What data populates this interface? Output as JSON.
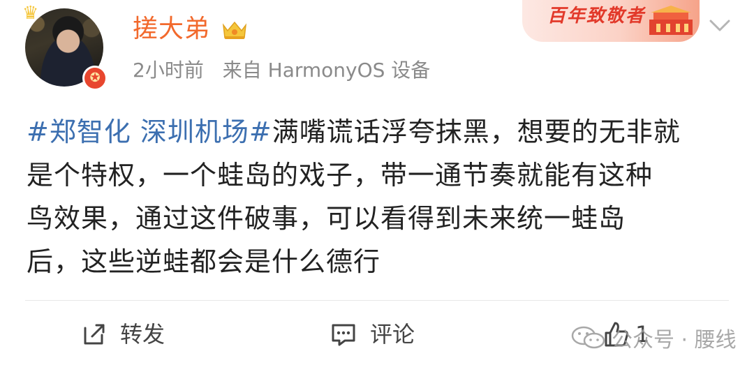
{
  "post": {
    "username": "搓大弟",
    "time": "2小时前",
    "source": "来自 HarmonyOS 设备",
    "banner_text": "百年致敬者",
    "content": {
      "tag1": "#郑智化 深圳机场#",
      "line1_rest": "满嘴谎话浮夸抹黑，想要的无非就",
      "line2": "是个特权，一个蛙岛的戏子，带一通节奏就能有这种",
      "line3": "鸟效果，通过这件破事，可以看得到未来统一蛙岛",
      "line4": "后，这些逆蛙都会是什么德行"
    }
  },
  "actions": {
    "repost_label": "转发",
    "comment_label": "评论",
    "like_count": "1"
  },
  "watermark": {
    "text": "公众号 · 腰线"
  },
  "colors": {
    "username": "#f2692c",
    "hashtag": "#3c6fb0",
    "meta": "#8a8a8a",
    "text": "#222222"
  },
  "icons": [
    "crown-icon",
    "verified-badge-icon",
    "vip-crown-icon",
    "chevron-down-icon",
    "repost-icon",
    "comment-icon",
    "like-icon",
    "wechat-logo-icon"
  ]
}
